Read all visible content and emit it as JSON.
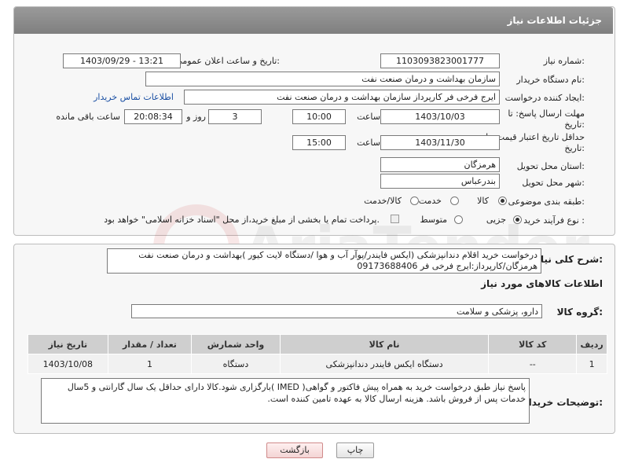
{
  "header": {
    "title": "جزئیات اطلاعات نیاز"
  },
  "fields": {
    "need_number_label": "شماره نیاز:",
    "need_number": "1103093823001777",
    "announce_label": "تاریخ و ساعت اعلان عمومی:",
    "announce_value": "1403/09/29 - 13:21",
    "buyer_label": "نام دستگاه خریدار:",
    "buyer_value": "سازمان بهداشت و درمان صنعت نفت",
    "creator_label": "ایجاد کننده درخواست:",
    "creator_value": "ایرج فرخی فر کارپرداز  سازمان بهداشت و درمان صنعت نفت",
    "contact_link": "اطلاعات تماس خریدار",
    "deadline_label_1": "مهلت ارسال پاسخ: تا",
    "deadline_label_2": "تاریخ:",
    "deadline_date": "1403/10/03",
    "time_label": "ساعت",
    "deadline_time": "10:00",
    "days_value": "3",
    "days_label": "روز و",
    "remaining_time": "20:08:34",
    "remaining_label": "ساعت باقی مانده",
    "validity_label_1": "حداقل تاریخ اعتبار قیمت: تا",
    "validity_label_2": "تاریخ:",
    "validity_date": "1403/11/30",
    "validity_time_label": "ساعت",
    "validity_time": "15:00",
    "province_label": "استان محل تحویل:",
    "province_value": "هرمزگان",
    "city_label": "شهر محل تحویل:",
    "city_value": "بندرعباس",
    "category_label": "طبقه بندی موضوعی:",
    "category_options": [
      "کالا",
      "خدمت",
      "کالا/خدمت"
    ],
    "category_selected": "کالا",
    "process_label": "نوع فرآیند خرید :",
    "process_options": [
      "جزیی",
      "متوسط"
    ],
    "process_selected": "جزیی",
    "payment_note": "پرداخت تمام یا بخشی از مبلغ خرید،از محل \"اسناد خزانه اسلامی\" خواهد بود."
  },
  "description": {
    "label": "شرح کلی نیاز:",
    "text": "درخواست خرید اقلام دندانپزشکی (ایکس فایندر/پوآر آب و هوا /دستگاه لایت کیور )بهداشت و درمان صنعت نفت هرمزگان/کارپرداز:ایرج فرخی فر 09173688406"
  },
  "goods_info_title": "اطلاعات کالاهای مورد نیاز",
  "goods_group": {
    "label": "گروه کالا:",
    "value": "دارو، پزشکی و سلامت"
  },
  "table": {
    "headers": [
      "ردیف",
      "کد کالا",
      "نام کالا",
      "واحد شمارش",
      "تعداد / مقدار",
      "تاریخ نیاز"
    ],
    "rows": [
      [
        "1",
        "--",
        "دستگاه ایکس فایندر دندانپزشکی",
        "دستگاه",
        "1",
        "1403/10/08"
      ]
    ]
  },
  "buyer_notes": {
    "label": "توضیحات خریدار:",
    "text": "پاسخ نیاز طبق درخواست خرید به همراه پیش فاکتور و گواهی( IMED )بارگزاری شود.کالا دارای حداقل یک سال گارانتی و 5سال خدمات پس از فروش باشد. هزینه ارسال کالا به عهده تامین کننده است."
  },
  "buttons": {
    "print": "چاپ",
    "back": "بازگشت"
  },
  "watermark": "AriaTender.net"
}
